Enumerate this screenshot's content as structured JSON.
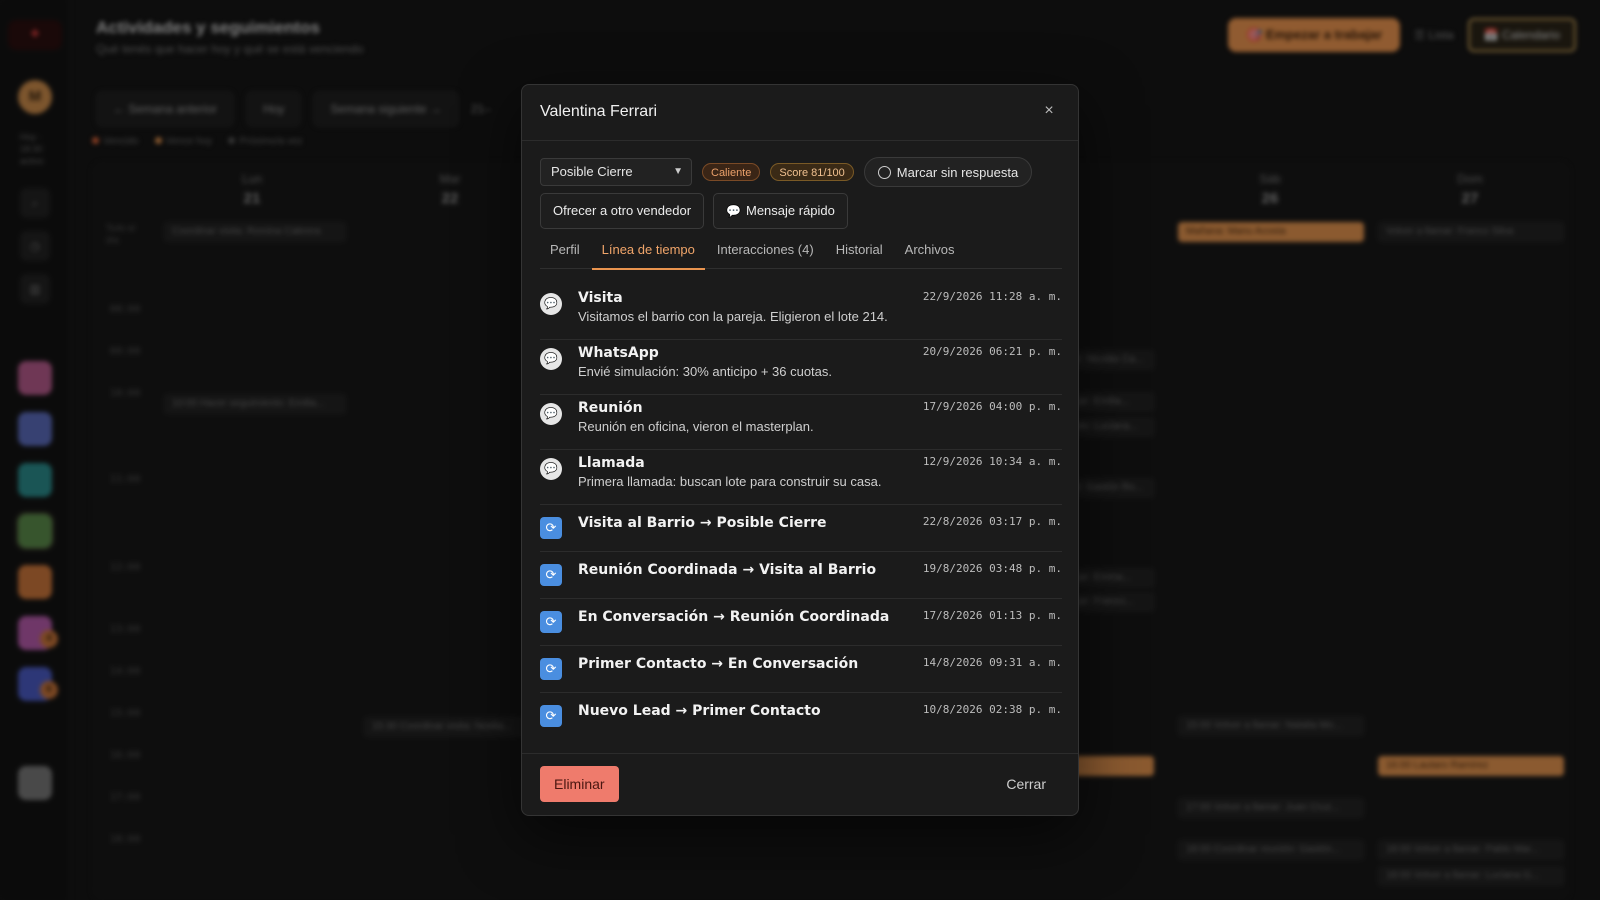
{
  "background": {
    "header": {
      "title": "Actividades y seguimientos",
      "subtitle": "Qué tenés que hacer hoy y qué se está venciendo"
    },
    "actions": {
      "start_work": "🎯 Empezar a trabajar",
      "list": "☰ Lista",
      "calendar": "📅 Calendario"
    },
    "rail": {
      "avatar_initial": "M",
      "info_line1": "Hoy ·",
      "info_line2": "18:30",
      "info_line3": "activo",
      "badge1": "4",
      "badge2": "6"
    },
    "toolbar": {
      "prev_week": "← Semana anterior",
      "today": "Hoy",
      "next_week": "Semana siguiente →",
      "range": "21–"
    },
    "legend": {
      "overdue": "Vencido",
      "due_today": "Vence hoy",
      "upcoming": "Próximo/a vez"
    },
    "calendar": {
      "days": [
        {
          "name": "Lun",
          "num": "21"
        },
        {
          "name": "Mar",
          "num": "22"
        },
        {
          "name": "Sáb",
          "num": "26"
        },
        {
          "name": "Dom",
          "num": "27"
        }
      ],
      "allday_label": "Todo el día",
      "hours": [
        "08:00",
        "09:00",
        "10:00",
        "11:00",
        "12:00",
        "13:00",
        "14:00",
        "15:00",
        "16:00",
        "17:00",
        "18:00"
      ],
      "events": {
        "mon_allday": "Coordinar visita: Romina Cabrera",
        "mon_1000": "10:00 Hacer seguimiento: Emilia...",
        "tue_1530": "15:30 Coordinar visita: Noelia...",
        "thu_a": "ar: Nicolás Ca...",
        "thu_b": "tuje: Emilia...",
        "thu_c": "ndo: Luciana...",
        "thu_d": "ar: Gastón Ro...",
        "thu_e": "tuje: Emma...",
        "thu_f": "tuje: Franco...",
        "sat_allday": "Mañana: Manu Acosta",
        "sun_allday": "Volver a llamar: Franco Silva",
        "sat_1530": "15:00 Volver a llamar: Natalia Mo...",
        "sun_1600": "16:00 Lautaro Ramírez",
        "sat_1700": "17:00 Volver a llamar: Juan Cruz...",
        "sat_1800": "18:00 Coordinar reunión: Gastón...",
        "sun_1800a": "18:00 Volver a llamar: Pablo Mar...",
        "sun_1800b": "18:00 Volver a llamar: Luciana G..."
      }
    }
  },
  "modal": {
    "title": "Valentina Ferrari",
    "close_icon": "×",
    "stage_select": {
      "value": "Posible Cierre"
    },
    "temperature_badge": "Caliente",
    "score_badge": "Score 81/100",
    "no_reply_label": "Marcar sin respuesta",
    "reassign_label": "Ofrecer a otro vendedor",
    "quick_message_label": "Mensaje rápido",
    "tabs": [
      {
        "label": "Perfil",
        "active": false
      },
      {
        "label": "Línea de tiempo",
        "active": true
      },
      {
        "label": "Interacciones (4)",
        "active": false
      },
      {
        "label": "Historial",
        "active": false
      },
      {
        "label": "Archivos",
        "active": false
      }
    ],
    "timeline": [
      {
        "kind": "note",
        "icon": "chat-bubble-icon",
        "title": "Visita",
        "desc": "Visitamos el barrio con la pareja. Eligieron el lote 214.",
        "date": "22/9/2026 11:28 a. m."
      },
      {
        "kind": "note",
        "icon": "chat-bubble-icon",
        "title": "WhatsApp",
        "desc": "Envié simulación: 30% anticipo + 36 cuotas.",
        "date": "20/9/2026 06:21 p. m."
      },
      {
        "kind": "note",
        "icon": "chat-bubble-icon",
        "title": "Reunión",
        "desc": "Reunión en oficina, vieron el masterplan.",
        "date": "17/9/2026 04:00 p. m."
      },
      {
        "kind": "note",
        "icon": "chat-bubble-icon",
        "title": "Llamada",
        "desc": "Primera llamada: buscan lote para construir su casa.",
        "date": "12/9/2026 10:34 a. m."
      },
      {
        "kind": "change",
        "icon": "sync-icon",
        "title": "Visita al Barrio → Posible Cierre",
        "date": "22/8/2026 03:17 p. m."
      },
      {
        "kind": "change",
        "icon": "sync-icon",
        "title": "Reunión Coordinada → Visita al Barrio",
        "date": "19/8/2026 03:48 p. m."
      },
      {
        "kind": "change",
        "icon": "sync-icon",
        "title": "En Conversación → Reunión Coordinada",
        "date": "17/8/2026 01:13 p. m."
      },
      {
        "kind": "change",
        "icon": "sync-icon",
        "title": "Primer Contacto → En Conversación",
        "date": "14/8/2026 09:31 a. m."
      },
      {
        "kind": "change",
        "icon": "sync-icon",
        "title": "Nuevo Lead → Primer Contacto",
        "date": "10/8/2026 02:38 p. m."
      }
    ],
    "footer": {
      "delete_label": "Eliminar",
      "close_label": "Cerrar"
    }
  },
  "colors": {
    "accent": "#e9944f",
    "danger": "#ef7b6c",
    "sync_icon": "#4a8ee0",
    "modal_bg": "#1b1b1b"
  }
}
